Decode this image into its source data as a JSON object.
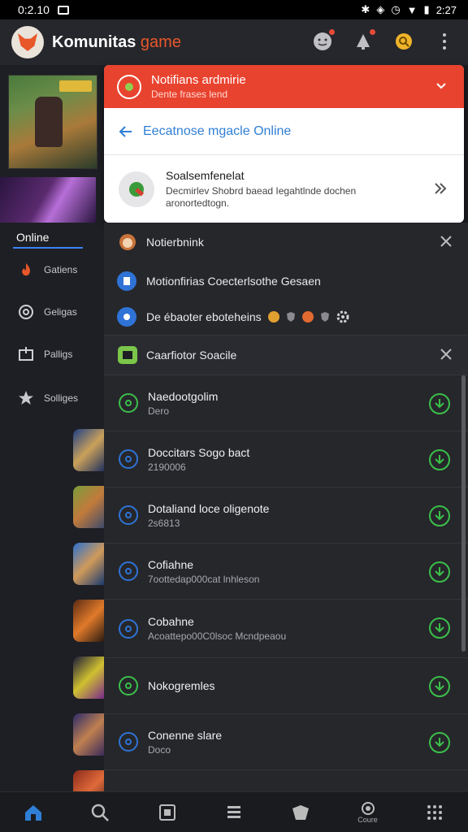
{
  "status_bar": {
    "time": "0:2.10",
    "right_time": "2:27"
  },
  "app": {
    "title_main": "Komunitas",
    "title_accent": "game"
  },
  "sidebar": {
    "heading": "Online",
    "items": [
      {
        "label": "Gatiens",
        "icon": "flame-icon",
        "color": "#e8572a"
      },
      {
        "label": "Geligas",
        "icon": "target-icon",
        "color": "#c8c8ce"
      },
      {
        "label": "Palligs",
        "icon": "inbox-icon",
        "color": "#c8c8ce"
      },
      {
        "label": "Solliges",
        "icon": "star-icon",
        "color": "#c8c8ce"
      }
    ]
  },
  "notification": {
    "header_title": "Notifians ardmirie",
    "header_sub": "Dente frases lend",
    "back_label": "Eecatnose mgacle Online",
    "item_title": "Soalsemfenelat",
    "item_desc": "Decmirlev Shobrd baead Iegahtlnde dochen aronortedtogn."
  },
  "sections": {
    "notifications_title": "Notierbnink",
    "row1": "Motionfirias Coecterlsothe Gesaen",
    "row2": "De ébaoter eboteheins",
    "favorites_title": "Caarfiotor Soacile"
  },
  "list": [
    {
      "title": "Naedootgolim",
      "sub": "Dero",
      "color": "#3bbf4a"
    },
    {
      "title": "Doccitars Sogo bact",
      "sub": "2190006",
      "color": "#2f73d6"
    },
    {
      "title": "Dotaliand loce oligenote",
      "sub": "2s6813",
      "color": "#2f73d6"
    },
    {
      "title": "Cofiahne",
      "sub": "7oottedap000cat lnhleson",
      "color": "#2f73d6"
    },
    {
      "title": "Cobahne",
      "sub": "Acoattepo00C0lsoc Mcndpeaou",
      "color": "#2f73d6"
    },
    {
      "title": "Nokogremles",
      "sub": "",
      "color": "#3bbf4a"
    },
    {
      "title": "Conenne slare",
      "sub": "Doco",
      "color": "#2f73d6"
    }
  ],
  "bottom_nav": {
    "profile_label": "Coure"
  },
  "colors": {
    "accent_red": "#e8432f",
    "link_blue": "#2f7fd6",
    "success_green": "#3bbf4a",
    "brand_orange": "#e8572a"
  }
}
